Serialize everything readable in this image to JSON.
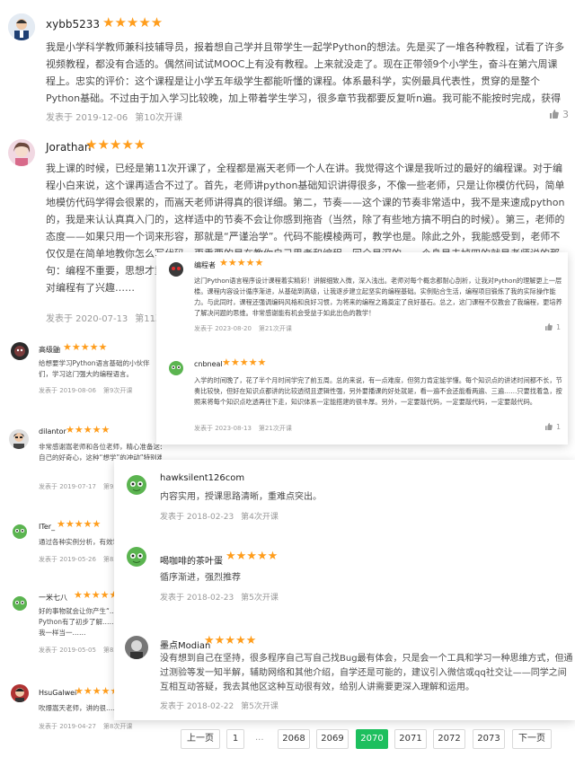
{
  "reviews": {
    "r1": {
      "user": "xybb5233",
      "stars": "★★★★★",
      "text": "我是小学科学教师兼科技辅导员，报着想自己学并且带学生一起学Python的想法。先是买了一堆各种教程，试看了许多视频教程，都没有合适的。偶然间试试MOOC上有没有教程。上来就没走了。现在正带领9个小学生，奋斗在第六周课程上。忠实的评价：这个课程是让小学五年级学生都能听懂的课程。体系最科学，实例最具代表性，贯穿的是整个Python基础。不过由于加入学习比较晚，加上带着学生学习，很多章节我都要反复听n遍。我可能不能按时完成，获得证书了。",
      "date": "发表于 2019-12-06",
      "term": "第10次开课",
      "likes": "3"
    },
    "r2": {
      "user": "Jorathan",
      "stars": "★★★★★",
      "text": "我上课的时候，已经是第11次开课了，全程都是嵩天老师一个人在讲。我觉得这个课是我听过的最好的编程课。对于编程小白来说，这个课再适合不过了。首先，老师讲python基础知识讲得很多，不像一些老师，只是让你模仿代码，简单地模仿代码学得会很累的，而嵩天老师讲得真的很详细。第二，节奏——这个课的节奏非常适中，我不是来速成python的，我是来认认真真入门的，这样适中的节奏不会让你感到拖沓（当然，除了有些地方搞不明白的时候）。第三，老师的态度——如果只用一个词来形容，那就是“严谨治学”。代码不能模棱两可，教学也是。除此之外，我能感受到，老师不仅仅是在简单地教你怎么写代码，更重要的是在教你自己思考和编程。回全是深的，一个身是去掉四的就是老师说的那句：编程不重要，思想才重要！！当然，这门课还有很多不足之处，因为什么原因，老师讲的不够详细……一个小白，对编程有了兴趣……",
      "date": "发表于 2020-07-13",
      "term": "第11次开课"
    },
    "r3": {
      "user": "高级鼬",
      "stars": "★★★★★",
      "text": "给想要学习Python语言基础的小伙伴们，学习这门强大的编程语言。",
      "date": "发表于 2019-08-06",
      "term": "第9次开课"
    },
    "r4": {
      "user": "dilantor",
      "stars": "★★★★★",
      "text": "非常感谢嵩老师和各位老师，精心准备这么好的课程，让有自由不便利的我能够自学Python……心，老师用很巧妙的方法提起了自己的好奇心，这种“想学”的冲动”特别难得！没丰事有上北京理工大学，能免费学习到这么好的课程！非常感谢！",
      "date": "发表于 2019-07-17",
      "term": "第9次开课"
    },
    "r5": {
      "user": "ITer_",
      "stars": "★★★★★",
      "text": "通过各种实例分析，有效地……",
      "date": "发表于 2019-05-26",
      "term": "第8次开课"
    },
    "r6": {
      "user": "一米七八",
      "stars": "★★★★★",
      "text": "好的事物就会让你产生“……也对Python有了初步了解……源，而不是像我一样当一……",
      "date": "发表于 2019-05-05",
      "term": "第8次开课"
    },
    "r7": {
      "user": "HsuGalwei",
      "stars": "★★★★★",
      "text": "吹爆嵩天老师，讲的很……",
      "date": "发表于 2019-04-27",
      "term": "第8次开课"
    },
    "r8": {
      "user": "编程者",
      "stars": "★★★★★",
      "text": "这门Python语言程序设计课程着实精彩！讲解细致入微，深入浅出。老师对每个概念都耐心剖析，让我对Python的理解更上一层楼。课程内容设计循序渐进，从基础到高级，让我逐步建立起坚实的编程基础。实例贴合生活，编程项目锻炼了我的实际操作能力。与此同时，课程还强调编码风格和良好习惯，为将来的编程之路奠定了良好基石。总之，这门课程不仅教会了我编程，更培养了解决问题的思维。非常感谢能有机会受益于如此出色的教学！",
      "date": "发表于 2023-08-20",
      "term": "第21次开课",
      "likes": "1"
    },
    "r9": {
      "user": "cnbneal",
      "stars": "★★★★★",
      "text": "入学的时间晚了，花了半个月时间学完了前五周。总的来说，有一点难度，但努力肯定能学懂。每个知识点的讲述时间都不长，节奏比较快，但好在知识点都讲的比较透彻且逻辑性强，另外要播课的好处就是，看一遍不会还能看两遍、三遍……只要找着急，按照来将每个知识点吃透再往下走，知识体系一定能搭建的很丰厚。另外，一定要敲代码，一定要敲代码，一定要敲代码。",
      "date": "发表于 2023-08-13",
      "term": "第21次开课",
      "likes": "1"
    },
    "r10": {
      "user": "hawksilent126com",
      "stars": "★★★★★",
      "text": "内容实用，授课思路清晰，重难点突出。",
      "date": "发表于 2018-02-23",
      "term": "第4次开课"
    },
    "r11": {
      "user": "喝咖啡的茶叶蛋",
      "stars": "★★★★★",
      "text": "循序渐进，强烈推荐",
      "date": "发表于 2018-02-23",
      "term": "第5次开课"
    },
    "r12": {
      "user": "墨点Modian",
      "stars": "★★★★★",
      "text": "没有想到自己在坚持，很多程序自己写自己找Bug最有体会，只是会一个工具和学习一种思维方式，但通过测验等发一知半解，辅助网络和其他介绍，自学还是可能的，建议引入微信或qq社交让——同学之间互相互动答疑，我去其他区这种互动很有效，给别人讲需要更深入理解和运用。",
      "date": "发表于 2018-02-22",
      "term": "第5次开课"
    }
  },
  "pagination": {
    "prev": "上一页",
    "first": "1",
    "ellipsis": "...",
    "pages": [
      "2068",
      "2069",
      "2070",
      "2071",
      "2072",
      "2073"
    ],
    "active": "2070",
    "next": "下一页"
  },
  "colors": {
    "star": "#ff9d1c",
    "active_page": "#1dbf5e"
  }
}
